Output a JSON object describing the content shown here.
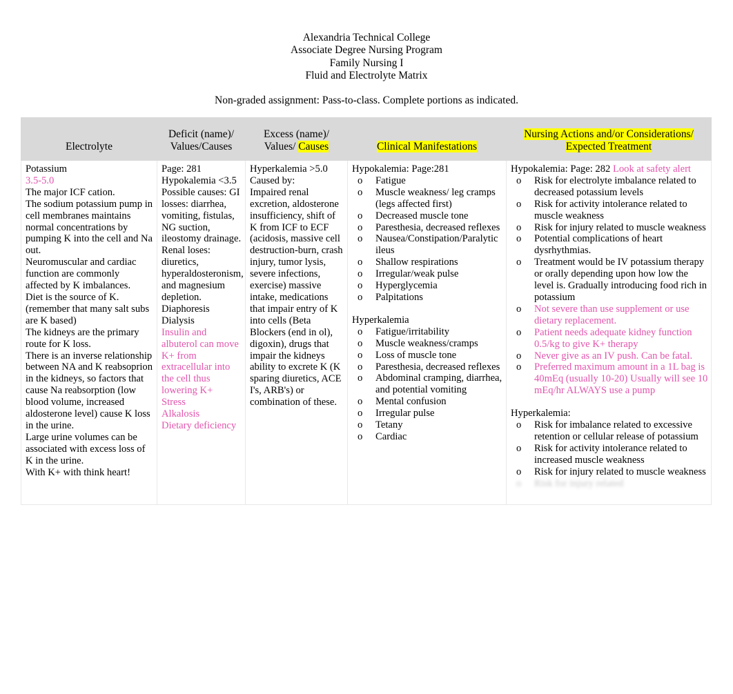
{
  "header": {
    "lines": [
      "Alexandria Technical College",
      "Associate Degree Nursing Program",
      "Family Nursing I",
      "Fluid and Electrolyte Matrix"
    ],
    "note": "Non-graded assignment: Pass-to-class. Complete portions as indicated."
  },
  "colors": {
    "header_background": "#d9d9d9",
    "highlight": "#ffff00",
    "pink_text": "#e254ad",
    "border": "#e8e8e8"
  },
  "table": {
    "columns": [
      {
        "key": "electrolyte",
        "header_lines": [
          {
            "text": "Electrolyte",
            "highlight": false
          }
        ]
      },
      {
        "key": "deficit",
        "header_lines": [
          {
            "text": "Deficit (name)/",
            "highlight": false
          },
          {
            "text": "Values/Causes",
            "highlight": false
          }
        ]
      },
      {
        "key": "excess",
        "header_lines": [
          {
            "text": "Excess (name)/",
            "highlight": false
          },
          {
            "text": "Values/ ",
            "highlight": false
          },
          {
            "text": "Causes",
            "highlight": true
          }
        ]
      },
      {
        "key": "manifestations",
        "header_lines": [
          {
            "text": "Clinical Manifestations",
            "highlight": true
          }
        ]
      },
      {
        "key": "nursing",
        "header_lines": [
          {
            "text": "Nursing Actions and/or Considerations/",
            "highlight": true
          },
          {
            "text": "Expected Treatment",
            "highlight": true
          }
        ]
      }
    ],
    "row": {
      "electrolyte": {
        "lines": [
          {
            "text": "Potassium",
            "pink": false
          },
          {
            "text": "3.5-5.0",
            "pink": true
          },
          {
            "text": "The major ICF cation.",
            "pink": false
          },
          {
            "text": "The sodium potassium pump in cell membranes maintains normal concentrations by pumping K into the cell and Na out.",
            "pink": false
          },
          {
            "text": "Neuromuscular and cardiac function are commonly affected by K imbalances.",
            "pink": false
          },
          {
            "text": "Diet is the source of K. (remember that many salt subs are K based)",
            "pink": false
          },
          {
            "text": "The kidneys are the primary route for K loss.",
            "pink": false
          },
          {
            "text": "There is an inverse relationship between NA and K reabsoprion in the kidneys, so factors that cause Na reabsorption (low blood volume, increased aldosterone level) cause K loss in the urine.",
            "pink": false
          },
          {
            "text": "Large urine volumes can be associated with excess loss of K in the urine.",
            "pink": false
          },
          {
            "text": "With K+ with think heart!",
            "pink": false
          }
        ]
      },
      "deficit": {
        "lines": [
          {
            "text": "Page: 281",
            "pink": false
          },
          {
            "text": "Hypokalemia <3.5",
            "pink": false
          },
          {
            "text": "Possible causes: GI losses: diarrhea, vomiting, fistulas, NG suction, ileostomy drainage.",
            "pink": false
          },
          {
            "text": "Renal loses: diuretics, hyperaldosteronism, and magnesium depletion.",
            "pink": false
          },
          {
            "text": "Diaphoresis",
            "pink": false
          },
          {
            "text": "Dialysis",
            "pink": false
          },
          {
            "text": "Insulin and albuterol can move K+ from extracellular into the cell thus lowering K+",
            "pink": true
          },
          {
            "text": "Stress",
            "pink": true
          },
          {
            "text": "Alkalosis",
            "pink": true
          },
          {
            "text": "Dietary deficiency",
            "pink": true
          }
        ]
      },
      "excess": {
        "lines": [
          {
            "text": "Hyperkalemia >5.0",
            "pink": false
          },
          {
            "text": "Caused by:",
            "pink": false
          },
          {
            "text": "Impaired renal excretion, aldosterone insufficiency, shift of K from ICF to ECF (acidosis, massive cell destruction-burn, crash injury, tumor lysis, severe infections, exercise) massive intake, medications that impair entry of K into cells (Beta Blockers (end in ol), digoxin), drugs that impair the kidneys ability to excrete K (K sparing diuretics, ACE I's, ARB's) or combination of these.",
            "pink": false
          }
        ]
      },
      "manifestations": {
        "groups": [
          {
            "heading": "Hypokalemia:  Page:281",
            "heading_pink": false,
            "items": [
              {
                "text": "Fatigue",
                "pink": false
              },
              {
                "text": "Muscle weakness/ leg cramps (legs affected first)",
                "pink": false
              },
              {
                "text": "Decreased muscle tone",
                "pink": false
              },
              {
                "text": "Paresthesia, decreased reflexes",
                "pink": false
              },
              {
                "text": "Nausea/Constipation/Paralytic ileus",
                "pink": false
              },
              {
                "text": "Shallow respirations",
                "pink": false
              },
              {
                "text": "Irregular/weak pulse",
                "pink": false
              },
              {
                "text": "Hyperglycemia",
                "pink": false
              },
              {
                "text": "Palpitations",
                "pink": false
              }
            ]
          },
          {
            "heading": "Hyperkalemia",
            "heading_pink": false,
            "items": [
              {
                "text": "Fatigue/irritability",
                "pink": false
              },
              {
                "text": "Muscle weakness/cramps",
                "pink": false
              },
              {
                "text": "Loss of muscle tone",
                "pink": false
              },
              {
                "text": "Paresthesia, decreased reflexes",
                "pink": false
              },
              {
                "text": "Abdominal cramping, diarrhea, and potential vomiting",
                "pink": false
              },
              {
                "text": "Mental confusion",
                "pink": false
              },
              {
                "text": "Irregular pulse",
                "pink": false
              },
              {
                "text": "Tetany",
                "pink": false
              },
              {
                "text": "Cardiac",
                "pink": false
              }
            ]
          }
        ]
      },
      "nursing": {
        "groups": [
          {
            "heading": "Hypokalemia: Page: 282 ",
            "heading_suffix": "Look at safety alert",
            "heading_suffix_pink": true,
            "items": [
              {
                "text": "Risk for electrolyte imbalance related to decreased potassium levels",
                "pink": false
              },
              {
                "text": "Risk for activity intolerance related to muscle weakness",
                "pink": false
              },
              {
                "text": "Risk for injury related to muscle weakness",
                "pink": false
              },
              {
                "text": "Potential complications of heart dysrhythmias.",
                "pink": false
              },
              {
                "text": "Treatment would be IV potassium therapy or orally depending upon how low the level is. Gradually introducing food rich in potassium",
                "pink": false
              },
              {
                "text": "Not severe than use supplement or use dietary replacement.",
                "pink": true
              },
              {
                "text": "Patient needs adequate kidney function 0.5/kg to give K+ therapy",
                "pink": true
              },
              {
                "text": "Never give as an IV push. Can be fatal.",
                "pink": true
              },
              {
                "text": "Preferred maximum amount in a 1L bag is 40mEq (usually 10-20) Usually will see 10 mEq/hr ALWAYS use a pump",
                "pink": true
              }
            ]
          },
          {
            "heading": "Hyperkalemia:",
            "heading_suffix": "",
            "heading_suffix_pink": false,
            "items": [
              {
                "text": "Risk for imbalance related to excessive retention or cellular release of potassium",
                "pink": false
              },
              {
                "text": "Risk for activity intolerance related to increased muscle weakness",
                "pink": false
              },
              {
                "text": "Risk for injury related to muscle weakness",
                "pink": false
              }
            ],
            "obscured_items": [
              {
                "text": "Risk for injury related",
                "pink": false
              }
            ]
          }
        ]
      }
    }
  },
  "bullet_marker": "o"
}
